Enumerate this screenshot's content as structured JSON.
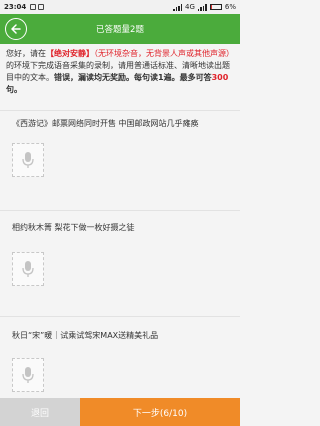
{
  "status_bar": {
    "time": "23:04",
    "network": "4G",
    "battery": "6%"
  },
  "header": {
    "title": "已答题量2题"
  },
  "instructions": {
    "p1": "您好，请在",
    "p2": "【绝对安静】",
    "p3": "（无环境杂音，无背景人声或其他声源）",
    "p4": "的环境下完成语音采集的录制，请用普通话标准、清晰地读出题目中的文本。",
    "p5": "错误，漏读均无奖励。每句读1遍。最多可答",
    "p6": "300",
    "p7": "句。"
  },
  "sentences": [
    {
      "text": "《西游记》邮票网络同时开售 中国邮政网站几乎瘫痪"
    },
    {
      "text": "相约秋木箐 梨花下做一枚好摄之徒"
    },
    {
      "text": "秋日“宋”暖｜试乘试驾宋MAX送精美礼品"
    }
  ],
  "buttons": {
    "back": "退回",
    "next": "下一步(6/10)"
  },
  "colors": {
    "header_green": "#4bab3c",
    "accent_red": "#e0222a",
    "next_orange": "#f08b28",
    "back_gray": "#d3d3d3"
  }
}
